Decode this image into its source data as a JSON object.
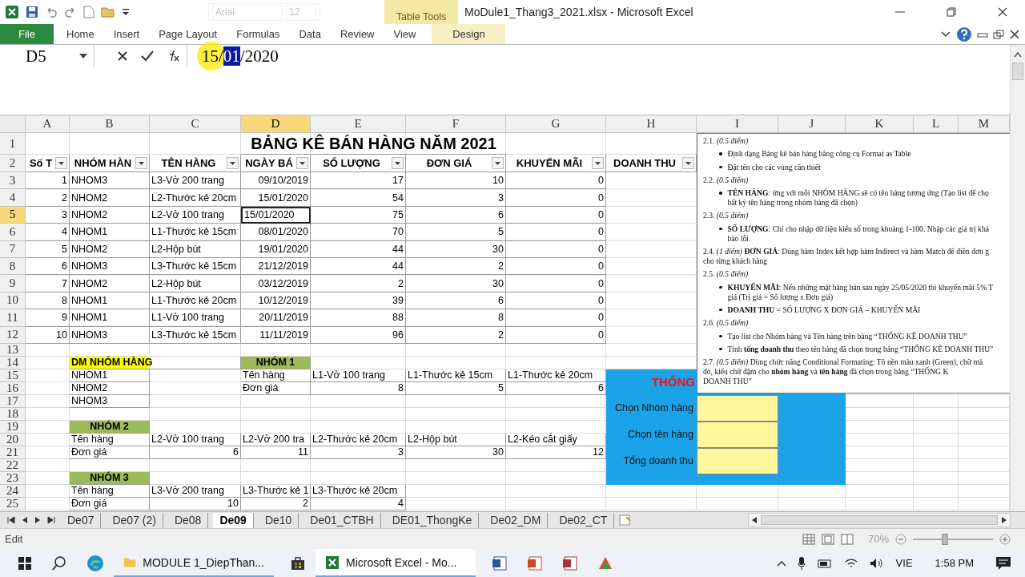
{
  "window": {
    "title": "MoDule1_Thang3_2021.xlsx  -  Microsoft Excel",
    "context_group": "Table Tools"
  },
  "mini_toolbar": {
    "font": "Arial",
    "size": "12"
  },
  "ribbon_tabs": [
    {
      "label": "File",
      "kind": "file"
    },
    {
      "label": "Home",
      "kind": "tab"
    },
    {
      "label": "Insert",
      "kind": "tab"
    },
    {
      "label": "Page Layout",
      "kind": "tab"
    },
    {
      "label": "Formulas",
      "kind": "tab"
    },
    {
      "label": "Data",
      "kind": "tab"
    },
    {
      "label": "Review",
      "kind": "tab"
    },
    {
      "label": "View",
      "kind": "tab"
    },
    {
      "label": "Design",
      "kind": "context"
    }
  ],
  "formula_bar": {
    "name_box": "D5",
    "before": "15/",
    "selection": "01",
    "after": "/2020"
  },
  "sheet": {
    "columns": [
      {
        "label": "A",
        "selected": false
      },
      {
        "label": "B",
        "selected": false
      },
      {
        "label": "C",
        "selected": false
      },
      {
        "label": "D",
        "selected": true
      },
      {
        "label": "E",
        "selected": false
      },
      {
        "label": "F",
        "selected": false
      },
      {
        "label": "G",
        "selected": false
      },
      {
        "label": "H",
        "selected": false
      },
      {
        "label": "I",
        "selected": false
      },
      {
        "label": "J",
        "selected": false
      },
      {
        "label": "K",
        "selected": false
      },
      {
        "label": "L",
        "selected": false
      },
      {
        "label": "M",
        "selected": false
      }
    ],
    "rows": [
      {
        "number": "1",
        "selected": false,
        "cells": [
          null,
          null,
          null,
          {
            "text": "BẢNG KÊ BÁN HÀNG NĂM 2021",
            "kind": "title"
          }
        ]
      },
      {
        "number": "2",
        "selected": false,
        "cells": [
          {
            "text": "Số T",
            "kind": "header"
          },
          {
            "text": "NHÓM HÀN",
            "kind": "header"
          },
          {
            "text": "TÊN HÀNG",
            "kind": "header"
          },
          {
            "text": "NGÀY BÁ",
            "kind": "header"
          },
          {
            "text": "SỐ LƯỢNG",
            "kind": "header"
          },
          {
            "text": "ĐƠN GIÁ",
            "kind": "header"
          },
          {
            "text": "KHUYẾN MÃI",
            "kind": "header"
          },
          {
            "text": "DOANH THU",
            "kind": "header"
          }
        ]
      },
      {
        "number": "3",
        "selected": false,
        "cells": [
          {
            "text": "1",
            "kind": "number"
          },
          {
            "text": "NHOM3",
            "kind": "text"
          },
          {
            "text": "L3-Vở 200 trang",
            "kind": "text"
          },
          {
            "text": "09/10/2019",
            "kind": "number"
          },
          {
            "text": "17",
            "kind": "number"
          },
          {
            "text": "10",
            "kind": "number"
          },
          {
            "text": "0",
            "kind": "number"
          }
        ]
      },
      {
        "number": "4",
        "selected": false,
        "cells": [
          {
            "text": "2",
            "kind": "number"
          },
          {
            "text": "NHOM2",
            "kind": "text"
          },
          {
            "text": "L2-Thước kẻ 20cm",
            "kind": "text"
          },
          {
            "text": "15/01/2020",
            "kind": "number"
          },
          {
            "text": "54",
            "kind": "number"
          },
          {
            "text": "3",
            "kind": "number"
          },
          {
            "text": "0",
            "kind": "number"
          }
        ]
      },
      {
        "number": "5",
        "selected": true,
        "cells": [
          {
            "text": "3",
            "kind": "number"
          },
          {
            "text": "NHOM2",
            "kind": "text"
          },
          {
            "text": "L2-Vở 100 trang",
            "kind": "text"
          },
          {
            "text": "15/01/2020",
            "kind": "number"
          },
          {
            "text": "75",
            "kind": "number"
          },
          {
            "text": "6",
            "kind": "number"
          },
          {
            "text": "0",
            "kind": "number"
          }
        ]
      },
      {
        "number": "6",
        "selected": false,
        "cells": [
          {
            "text": "4",
            "kind": "number"
          },
          {
            "text": "NHOM1",
            "kind": "text"
          },
          {
            "text": "L1-Thước kẻ 15cm",
            "kind": "text"
          },
          {
            "text": "08/01/2020",
            "kind": "number"
          },
          {
            "text": "70",
            "kind": "number"
          },
          {
            "text": "5",
            "kind": "number"
          },
          {
            "text": "0",
            "kind": "number"
          }
        ]
      },
      {
        "number": "7",
        "selected": false,
        "cells": [
          {
            "text": "5",
            "kind": "number"
          },
          {
            "text": "NHOM2",
            "kind": "text"
          },
          {
            "text": "L2-Hộp bút",
            "kind": "text"
          },
          {
            "text": "19/01/2020",
            "kind": "number"
          },
          {
            "text": "44",
            "kind": "number"
          },
          {
            "text": "30",
            "kind": "number"
          },
          {
            "text": "0",
            "kind": "number"
          }
        ]
      },
      {
        "number": "8",
        "selected": false,
        "cells": [
          {
            "text": "6",
            "kind": "number"
          },
          {
            "text": "NHOM3",
            "kind": "text"
          },
          {
            "text": "L3-Thước kẻ 15cm",
            "kind": "text"
          },
          {
            "text": "21/12/2019",
            "kind": "number"
          },
          {
            "text": "44",
            "kind": "number"
          },
          {
            "text": "2",
            "kind": "number"
          },
          {
            "text": "0",
            "kind": "number"
          }
        ]
      },
      {
        "number": "9",
        "selected": false,
        "cells": [
          {
            "text": "7",
            "kind": "number"
          },
          {
            "text": "NHOM2",
            "kind": "text"
          },
          {
            "text": "L2-Hộp bút",
            "kind": "text"
          },
          {
            "text": "03/12/2019",
            "kind": "number"
          },
          {
            "text": "2",
            "kind": "number"
          },
          {
            "text": "30",
            "kind": "number"
          },
          {
            "text": "0",
            "kind": "number"
          }
        ]
      },
      {
        "number": "10",
        "selected": false,
        "cells": [
          {
            "text": "8",
            "kind": "number"
          },
          {
            "text": "NHOM1",
            "kind": "text"
          },
          {
            "text": "L1-Thước kẻ 20cm",
            "kind": "text"
          },
          {
            "text": "10/12/2019",
            "kind": "number"
          },
          {
            "text": "39",
            "kind": "number"
          },
          {
            "text": "6",
            "kind": "number"
          },
          {
            "text": "0",
            "kind": "number"
          }
        ]
      },
      {
        "number": "11",
        "selected": false,
        "cells": [
          {
            "text": "9",
            "kind": "number"
          },
          {
            "text": "NHOM1",
            "kind": "text"
          },
          {
            "text": "L1-Vở 100 trang",
            "kind": "text"
          },
          {
            "text": "20/11/2019",
            "kind": "number"
          },
          {
            "text": "88",
            "kind": "number"
          },
          {
            "text": "8",
            "kind": "number"
          },
          {
            "text": "0",
            "kind": "number"
          }
        ]
      },
      {
        "number": "12",
        "selected": false,
        "cells": [
          {
            "text": "10",
            "kind": "number"
          },
          {
            "text": "NHOM3",
            "kind": "text"
          },
          {
            "text": "L3-Thước kẻ 15cm",
            "kind": "text"
          },
          {
            "text": "11/11/2019",
            "kind": "number"
          },
          {
            "text": "96",
            "kind": "number"
          },
          {
            "text": "2",
            "kind": "number"
          },
          {
            "text": "0",
            "kind": "number"
          }
        ]
      },
      {
        "number": "13",
        "selected": false,
        "cells": []
      },
      {
        "number": "14",
        "selected": false,
        "cells": [
          null,
          {
            "text": "DM NHÓM HÀNG",
            "kind": "label-yellow"
          },
          null,
          {
            "text": "NHÓM 1",
            "kind": "label-green"
          }
        ]
      },
      {
        "number": "15",
        "selected": false,
        "cells": [
          null,
          {
            "text": "NHOM1",
            "kind": "text"
          },
          null,
          {
            "text": "Tên hàng",
            "kind": "text"
          },
          {
            "text": "L1-Vở 100 trang",
            "kind": "text"
          },
          {
            "text": "L1-Thước kẻ 15cm",
            "kind": "text"
          },
          {
            "text": "L1-Thước kẻ 20cm",
            "kind": "text"
          }
        ]
      },
      {
        "number": "16",
        "selected": false,
        "cells": [
          null,
          {
            "text": "NHOM2",
            "kind": "text"
          },
          null,
          {
            "text": "Đơn giá",
            "kind": "text"
          },
          {
            "text": "8",
            "kind": "number"
          },
          {
            "text": "5",
            "kind": "number"
          },
          {
            "text": "6",
            "kind": "number"
          }
        ]
      },
      {
        "number": "17",
        "selected": false,
        "cells": [
          null,
          {
            "text": "NHOM3",
            "kind": "text"
          }
        ]
      },
      {
        "number": "18",
        "selected": false,
        "cells": []
      },
      {
        "number": "19",
        "selected": false,
        "cells": [
          null,
          {
            "text": "NHÓM 2",
            "kind": "label-green"
          }
        ]
      },
      {
        "number": "20",
        "selected": false,
        "cells": [
          null,
          {
            "text": "Tên hàng",
            "kind": "text"
          },
          {
            "text": "L2-Vở 100 trang",
            "kind": "text"
          },
          {
            "text": "L2-Vở 200 tra",
            "kind": "text"
          },
          {
            "text": "L2-Thước kẻ 20cm",
            "kind": "text"
          },
          {
            "text": "L2-Hộp bút",
            "kind": "text"
          },
          {
            "text": "L2-Kéo cắt giấy",
            "kind": "text"
          }
        ]
      },
      {
        "number": "21",
        "selected": false,
        "cells": [
          null,
          {
            "text": "Đơn giá",
            "kind": "text"
          },
          {
            "text": "6",
            "kind": "number"
          },
          {
            "text": "11",
            "kind": "number"
          },
          {
            "text": "3",
            "kind": "number"
          },
          {
            "text": "30",
            "kind": "number"
          },
          {
            "text": "12",
            "kind": "number"
          }
        ]
      },
      {
        "number": "22",
        "selected": false,
        "cells": []
      },
      {
        "number": "23",
        "selected": false,
        "cells": [
          null,
          {
            "text": "NHÓM 3",
            "kind": "label-green"
          }
        ]
      },
      {
        "number": "24",
        "selected": false,
        "cells": [
          null,
          {
            "text": "Tên hàng",
            "kind": "text"
          },
          {
            "text": "L3-Vở 200 trang",
            "kind": "text"
          },
          {
            "text": "L3-Thước kẻ 1",
            "kind": "text"
          },
          {
            "text": "L3-Thước kẻ 20cm",
            "kind": "text"
          }
        ]
      },
      {
        "number": "25",
        "selected": false,
        "cells": [
          null,
          {
            "text": "Đơn giá",
            "kind": "text"
          },
          {
            "text": "10",
            "kind": "number"
          },
          {
            "text": "2",
            "kind": "number"
          },
          {
            "text": "4",
            "kind": "number"
          }
        ]
      }
    ]
  },
  "stats_panel": {
    "title": "THỐNG",
    "fields": [
      {
        "label": "Chọn Nhóm hàng"
      },
      {
        "label": "Chọn tên hàng"
      },
      {
        "label": "Tổng doanh thu"
      }
    ]
  },
  "note_box": [
    {
      "kind": "heading",
      "lines": [
        "2.1. *(0.5 điểm)*"
      ]
    },
    {
      "kind": "bullet",
      "lines": [
        "Định dạng Bảng kê bán hàng bằng công cụ Format as Table"
      ]
    },
    {
      "kind": "bullet",
      "lines": [
        "Đặt tên cho các vùng cần thiết"
      ]
    },
    {
      "kind": "heading",
      "lines": [
        "2.2. *(0.5 điểm)*"
      ]
    },
    {
      "kind": "bullet",
      "lines": [
        "**TÊN HÀNG**: ứng với mỗi NHÓM HÀNG sẽ có tên hàng tương ứng (Tạo list để chọ",
        "bất kỳ tên hàng trong nhóm hàng đã chọn)"
      ]
    },
    {
      "kind": "heading",
      "lines": [
        "2.3. *(0.5 điểm)*"
      ]
    },
    {
      "kind": "bullet",
      "lines": [
        "**SỐ LƯỢNG**: Chỉ cho nhập dữ liệu kiểu số trong khoảng 1-100. Nhập các giá trị khá",
        "báo lỗi"
      ]
    },
    {
      "kind": "heading",
      "lines": [
        "2.4. *(1 điểm)* **ĐƠN GIÁ**: Dùng hàm Index kết hợp hàm Indirect và hàm Match để điền đơn g",
        "cho từng khách hàng"
      ]
    },
    {
      "kind": "heading",
      "lines": [
        "2.5. *(0.5 điểm)*"
      ]
    },
    {
      "kind": "bullet",
      "lines": [
        "**KHUYẾN MÃI**: Nếu những mặt hàng bán sau ngày 25/05/2020 thì khuyến mãi 5% T",
        "giá (Trị giá = Số lượng x Đơn giá)"
      ]
    },
    {
      "kind": "bullet",
      "lines": [
        "**DOANH THU** = SỐ LƯỢNG X ĐƠN GIÁ – KHUYẾN MÃI"
      ]
    },
    {
      "kind": "heading",
      "lines": [
        "2.6. *(0.5 điểm)*"
      ]
    },
    {
      "kind": "bullet",
      "lines": [
        "Tạo list cho Nhóm hàng và Tên hàng trên bảng “THỐNG KÊ DOANH THU”"
      ]
    },
    {
      "kind": "bullet",
      "lines": [
        "Tính **tổng doanh thu** theo tên hàng đã chọn trong bảng “THỐNG KÊ DOANH THU”"
      ]
    },
    {
      "kind": "heading",
      "lines": [
        "2.7. *(0.5 điểm)* Dùng chức năng Conditional Formating: Tô nền màu xanh (Green), chữ mà",
        "đỏ, kiểu chữ đậm cho **nhóm hàng** và **tên hàng** đã chọn trong bảng “THỐNG K",
        "DOANH THU”"
      ]
    }
  ],
  "sheet_tabs": [
    {
      "label": "De07",
      "selected": false
    },
    {
      "label": "De07 (2)",
      "selected": false
    },
    {
      "label": "De08",
      "selected": false
    },
    {
      "label": "De09",
      "selected": true
    },
    {
      "label": "De10",
      "selected": false
    },
    {
      "label": "De01_CTBH",
      "selected": false
    },
    {
      "label": "DE01_ThongKe",
      "selected": false
    },
    {
      "label": "De02_DM",
      "selected": false
    },
    {
      "label": "De02_CT",
      "selected": false
    }
  ],
  "status_bar": {
    "mode": "Edit",
    "zoom": "70%",
    "zoom_slider": {
      "level": 0.4
    }
  },
  "taskbar": {
    "apps": [
      {
        "label": "MODULE 1_DiepThan...",
        "kind": "folder",
        "selected": false
      },
      {
        "label": "Microsoft Excel - Mo...",
        "kind": "excel",
        "selected": true
      }
    ],
    "language": "VIE",
    "time": "1:58 PM"
  }
}
